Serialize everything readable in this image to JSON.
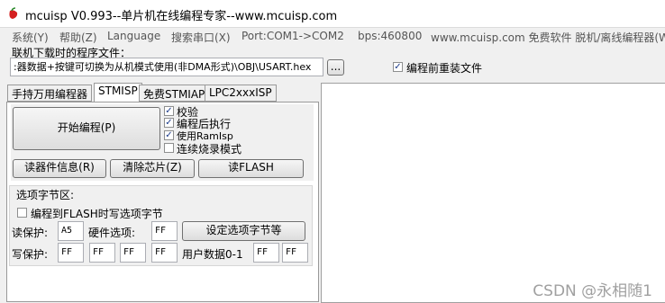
{
  "window": {
    "title": "mcuisp V0.993--单片机在线编程专家--www.mcuisp.com",
    "icon": "chili-pepper-icon"
  },
  "menu": [
    "系统(Y)",
    "帮助(Z)",
    "Language",
    "搜索串口(X)",
    "Port:COM1->COM2",
    "bps:460800",
    "www.mcuisp.com 免费软件 脱机/离线编程器(W"
  ],
  "program_file": {
    "label": "联机下载时的程序文件：",
    "path": ":器数据+按键可切换为从机模式使用(非DMA形式)\\OBJ\\USART.hex",
    "browse_label": "...",
    "reload_label": "编程前重装文件",
    "reload_checked": true
  },
  "tabs": [
    {
      "label": "手持万用编程器",
      "active": false
    },
    {
      "label": "STMISP",
      "active": true
    },
    {
      "label": "免费STMIAP",
      "active": false
    },
    {
      "label": "LPC2xxxISP",
      "active": false
    }
  ],
  "stmisp": {
    "start_button": "开始编程(P)",
    "options": [
      {
        "label": "校验",
        "checked": true
      },
      {
        "label": "编程后执行",
        "checked": true
      },
      {
        "label": "使用RamIsp",
        "checked": true
      },
      {
        "label": "连续烧录模式",
        "checked": false
      }
    ],
    "read_info_button": "读器件信息(R)",
    "erase_button": "清除芯片(Z)",
    "read_flash_button": "读FLASH",
    "option_bytes": {
      "group_label": "选项字节区:",
      "write_to_flash_label": "编程到FLASH时写选项字节",
      "write_to_flash_checked": false,
      "read_protect_label": "读保护:",
      "read_protect_value": "A5",
      "hw_option_label": "硬件选项:",
      "hw_option_value": "FF",
      "set_button": "设定选项字节等",
      "write_protect_label": "写保护:",
      "write_protect_values": [
        "FF",
        "FF",
        "FF",
        "FF"
      ],
      "user_data_label": "用户数据0-1",
      "user_data_values": [
        "FF",
        "FF"
      ]
    }
  },
  "watermark": "CSDN @永相随1"
}
